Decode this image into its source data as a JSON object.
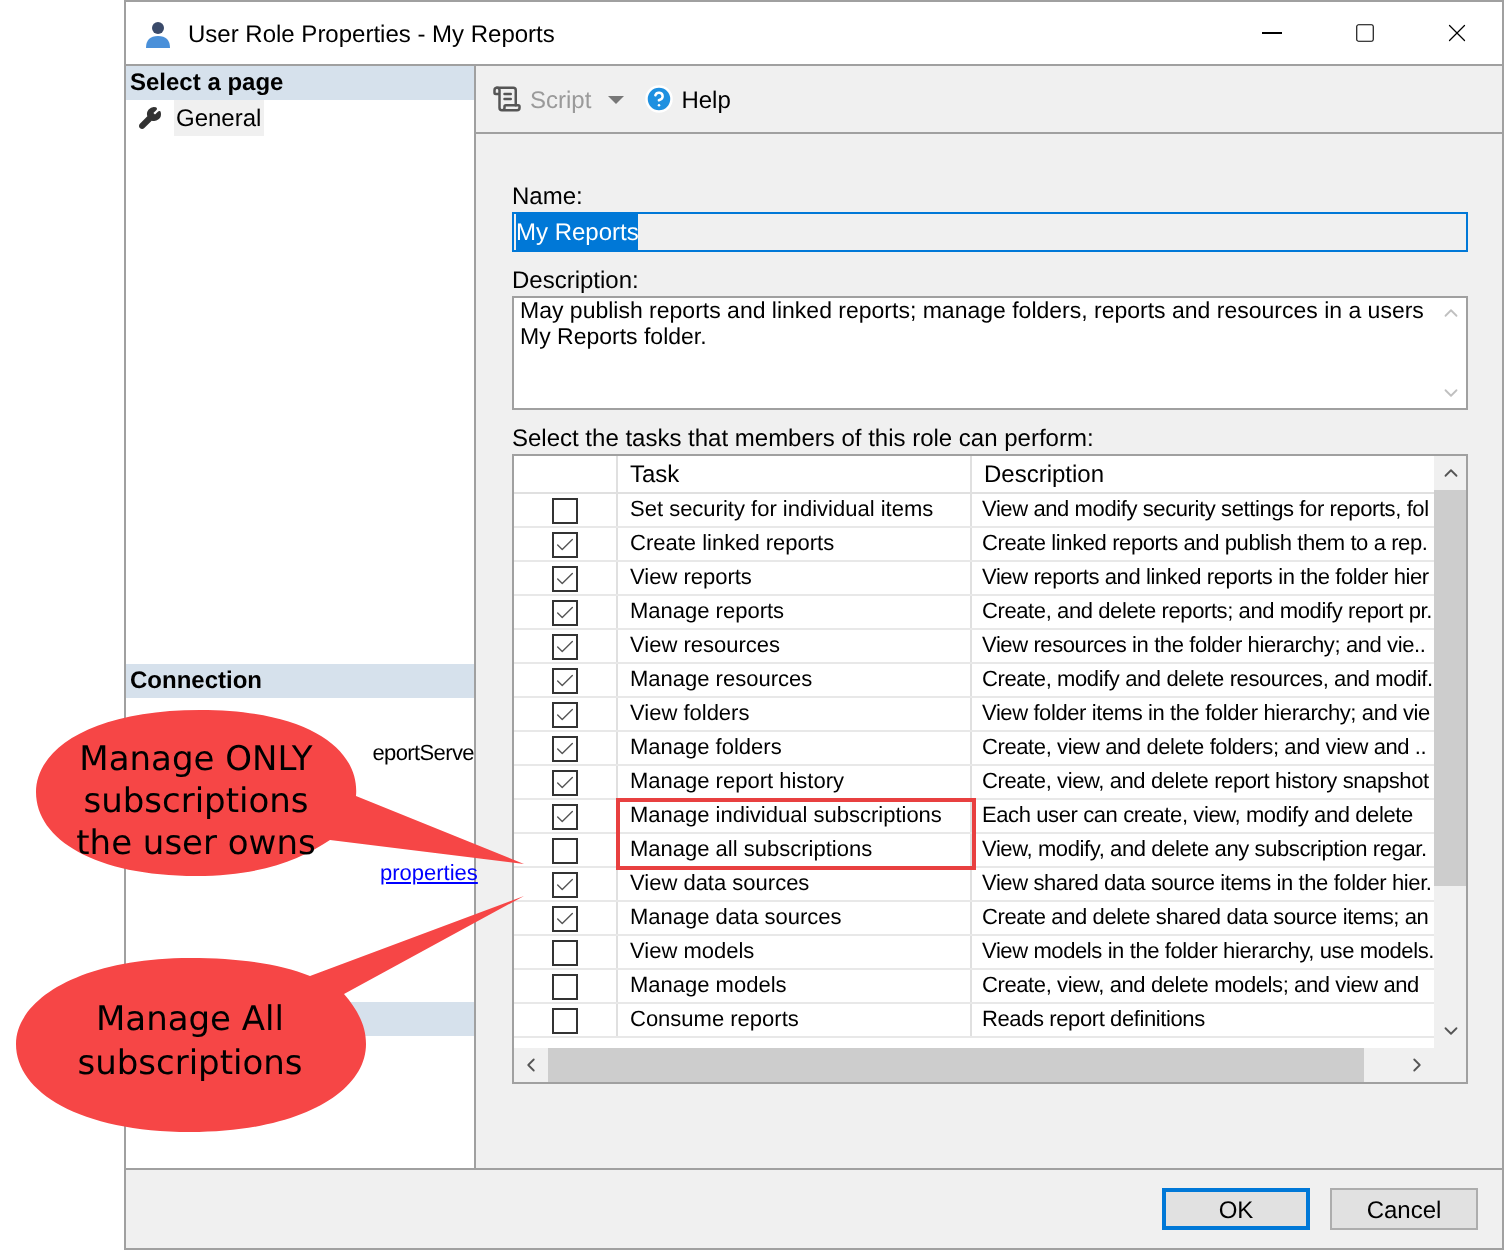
{
  "window": {
    "title": "User Role Properties - My Reports"
  },
  "sidebar": {
    "header": "Select a page",
    "items": [
      {
        "label": "General",
        "selected": true
      }
    ],
    "connection_header": "Connection",
    "connection_text": "eportServe",
    "connection_link": "properties"
  },
  "toolbar": {
    "script": "Script",
    "help": "Help"
  },
  "name": {
    "label": "Name:",
    "value": "My Reports"
  },
  "description": {
    "label": "Description:",
    "value": "May publish reports and linked reports; manage folders, reports and resources in a users My Reports folder."
  },
  "tasks_label": "Select the tasks that members of this role can perform:",
  "table": {
    "columns": [
      "Task",
      "Description"
    ],
    "rows": [
      {
        "task": "Set security for individual items",
        "description": "View and modify security settings for reports, fol",
        "checked": false,
        "highlighted": false
      },
      {
        "task": "Create linked reports",
        "description": "Create linked reports and publish them to a rep.",
        "checked": true,
        "highlighted": false
      },
      {
        "task": "View reports",
        "description": "View reports and linked reports in the folder hier",
        "checked": true,
        "highlighted": false
      },
      {
        "task": "Manage reports",
        "description": "Create, and delete reports; and modify report pr.",
        "checked": true,
        "highlighted": false
      },
      {
        "task": "View resources",
        "description": "View resources in the folder hierarchy; and vie..",
        "checked": true,
        "highlighted": false
      },
      {
        "task": "Manage resources",
        "description": "Create, modify and delete resources, and modif.",
        "checked": true,
        "highlighted": false
      },
      {
        "task": "View folders",
        "description": "View folder items in the folder hierarchy; and vie",
        "checked": true,
        "highlighted": false
      },
      {
        "task": "Manage folders",
        "description": "Create, view and delete folders; and view and ..",
        "checked": true,
        "highlighted": false
      },
      {
        "task": "Manage report history",
        "description": "Create, view, and delete report history snapshot",
        "checked": true,
        "highlighted": false
      },
      {
        "task": "Manage individual subscriptions",
        "description": "Each user can create, view, modify and delete",
        "checked": true,
        "highlighted": true
      },
      {
        "task": "Manage all subscriptions",
        "description": "View, modify, and delete any subscription regar.",
        "checked": false,
        "highlighted": true
      },
      {
        "task": "View data sources",
        "description": "View shared data source items in the folder hier.",
        "checked": true,
        "highlighted": false
      },
      {
        "task": "Manage data sources",
        "description": "Create and delete shared data source items; an",
        "checked": true,
        "highlighted": false
      },
      {
        "task": "View models",
        "description": "View models in the folder hierarchy, use models.",
        "checked": false,
        "highlighted": false
      },
      {
        "task": "Manage models",
        "description": "Create, view, and delete models; and view and",
        "checked": false,
        "highlighted": false
      },
      {
        "task": "Consume reports",
        "description": "Reads report definitions",
        "checked": false,
        "highlighted": false
      }
    ]
  },
  "buttons": [
    {
      "label": "OK",
      "default": true
    },
    {
      "label": "Cancel",
      "default": false
    }
  ],
  "callouts": [
    {
      "text": "Manage ONLY subscriptions the user owns"
    },
    {
      "text": "Manage All subscriptions"
    }
  ]
}
